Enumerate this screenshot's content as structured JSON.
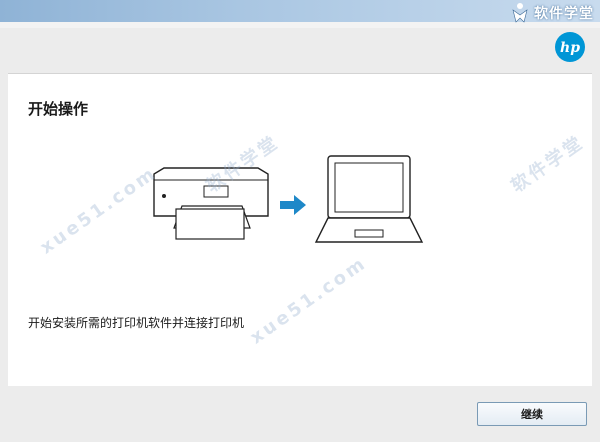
{
  "header": {
    "brand_name": "软件学堂",
    "vendor_logo": "hp-logo"
  },
  "main": {
    "title": "开始操作",
    "description": "开始安装所需的打印机软件并连接打印机",
    "illustration": {
      "left_icon": "printer-icon",
      "middle_icon": "arrow-right-icon",
      "right_icon": "laptop-icon",
      "arrow_color": "#1e88c8"
    }
  },
  "footer": {
    "continue_label": "继续"
  },
  "watermarks": {
    "site": "xue51.com",
    "brand": "软件学堂"
  },
  "colors": {
    "hp_blue": "#0096d6",
    "title_strip": "#a9c6e2"
  }
}
